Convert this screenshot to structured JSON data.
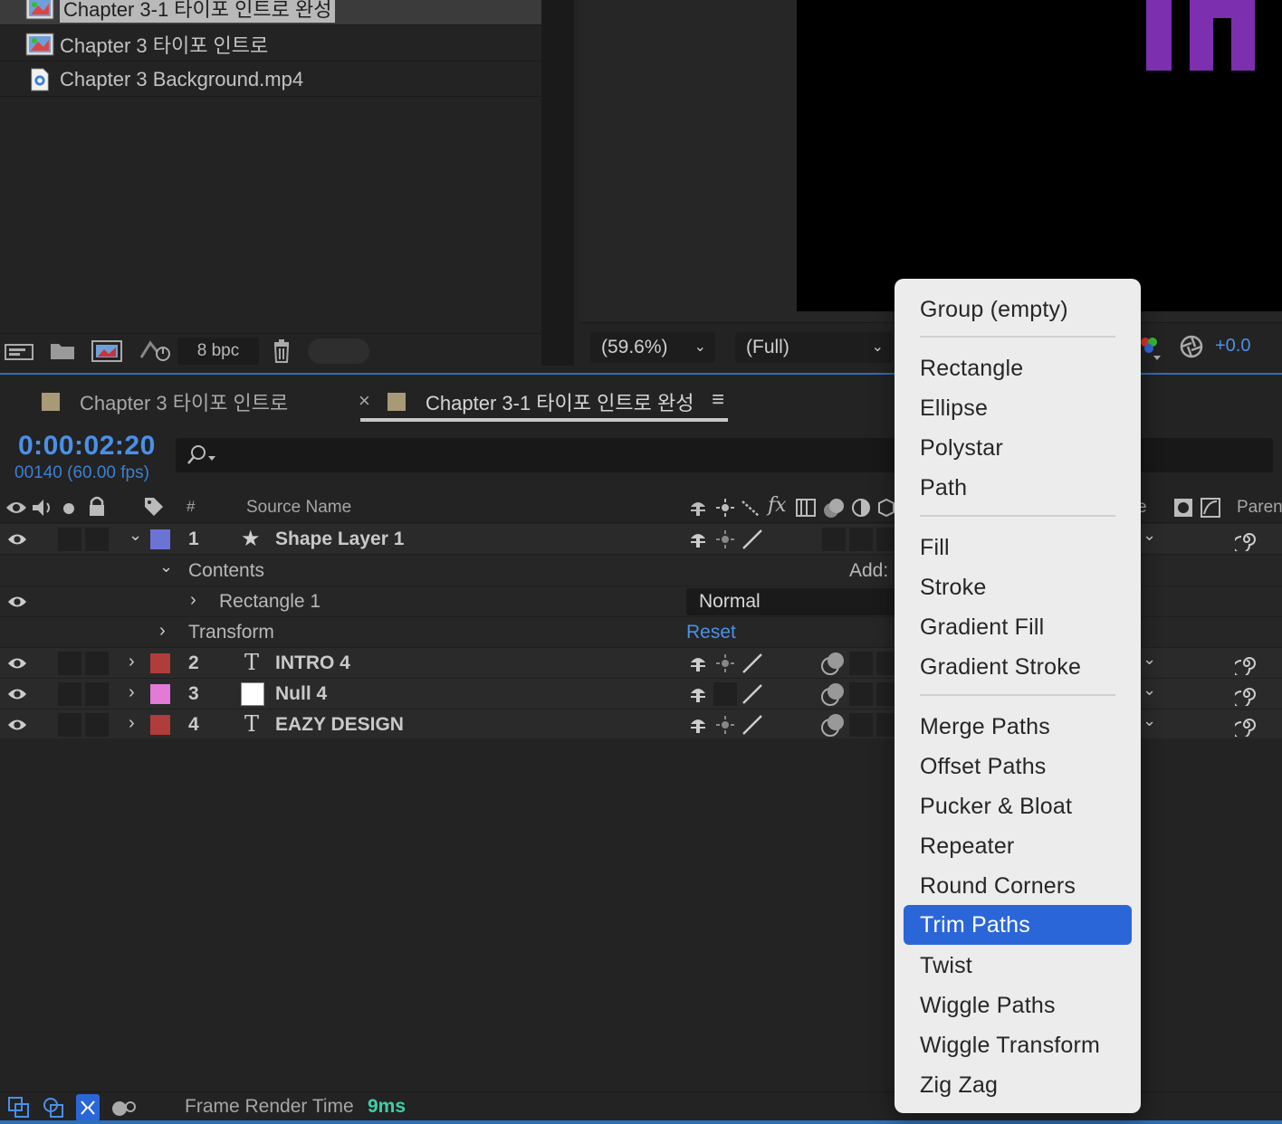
{
  "project": {
    "items": [
      {
        "name": "Chapter 3-1 타이포 인트로 완성",
        "type": "composition",
        "selected": true
      },
      {
        "name": "Chapter 3 타이포 인트로",
        "type": "composition",
        "selected": false
      },
      {
        "name": "Chapter 3 Background.mp4",
        "type": "footage",
        "selected": false
      }
    ],
    "footer": {
      "bpc": "8 bpc"
    }
  },
  "viewer": {
    "zoom": "(59.6%)",
    "resolution": "(Full)",
    "exposure": "+0.0"
  },
  "timeline": {
    "tabs": [
      {
        "label": "Chapter 3 타이포 인트로"
      },
      {
        "label": "Chapter 3-1 타이포 인트로 완성",
        "active": true
      }
    ],
    "tab_close": "×",
    "tab_menu": "≡",
    "timecode": "0:00:02:20",
    "frames": "00140 (60.00 fps)",
    "columns": {
      "hash": "#",
      "source_name": "Source Name",
      "mode": "e",
      "parent": "Parent"
    },
    "layers": [
      {
        "num": "1",
        "name": "Shape Layer 1",
        "color": "#6b74d4",
        "type": "shape"
      },
      {
        "num": "2",
        "name": "INTRO 4",
        "color": "#b03c3c",
        "type": "text"
      },
      {
        "num": "3",
        "name": "Null 4",
        "color": "#e27bd6",
        "type": "null"
      },
      {
        "num": "4",
        "name": "EAZY DESIGN",
        "color": "#b03c3c",
        "type": "text"
      }
    ],
    "contents_label": "Contents",
    "add_label": "Add:",
    "rectangle_label": "Rectangle 1",
    "blend_mode": "Normal",
    "transform_label": "Transform",
    "reset_label": "Reset",
    "text_type_glyph": "T",
    "frame_render_label": "Frame Render Time",
    "frame_render_value": "9ms"
  },
  "menu": {
    "items": [
      "Group (empty)",
      "Rectangle",
      "Ellipse",
      "Polystar",
      "Path",
      "Fill",
      "Stroke",
      "Gradient Fill",
      "Gradient Stroke",
      "Merge Paths",
      "Offset Paths",
      "Pucker & Bloat",
      "Repeater",
      "Round Corners",
      "Trim Paths",
      "Twist",
      "Wiggle Paths",
      "Wiggle Transform",
      "Zig Zag"
    ],
    "highlighted": "Trim Paths"
  },
  "colors": {
    "accent": "#4a90e8",
    "menu_highlight": "#2b66d9",
    "render_value": "#3fcfa8"
  }
}
